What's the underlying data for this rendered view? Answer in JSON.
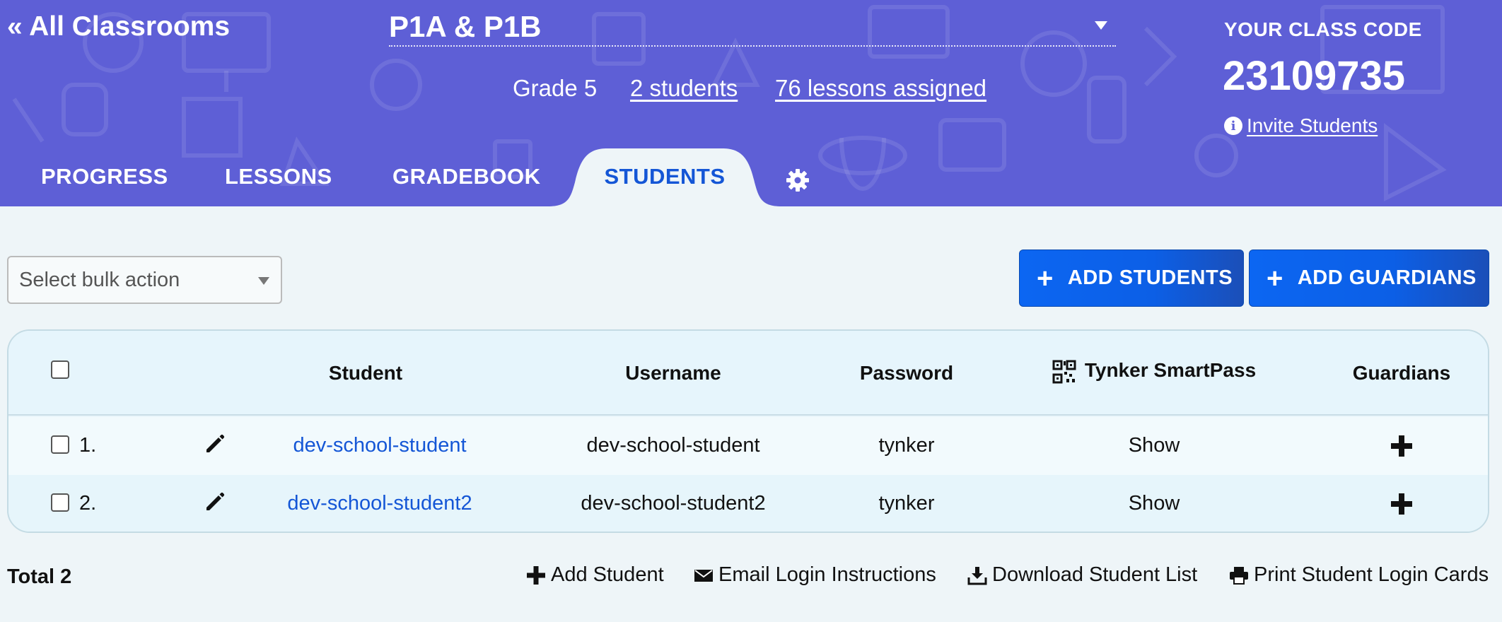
{
  "header": {
    "back_label": "« All Classrooms",
    "class_name": "P1A & P1B",
    "grade": "Grade 5",
    "students_link": "2 students",
    "lessons_link": "76 lessons assigned",
    "class_code_label": "YOUR CLASS CODE",
    "class_code": "23109735",
    "invite_label": " Invite Students",
    "bg_color": "#5e5fd6"
  },
  "tabs": [
    {
      "label": "PROGRESS",
      "active": false
    },
    {
      "label": "LESSONS",
      "active": false
    },
    {
      "label": "GRADEBOOK",
      "active": false
    },
    {
      "label": "STUDENTS",
      "active": true
    }
  ],
  "toolbar": {
    "bulk_action_placeholder": "Select bulk action",
    "add_students_label": "ADD STUDENTS",
    "add_guardians_label": "ADD GUARDIANS"
  },
  "table": {
    "columns": {
      "student": "Student",
      "username": "Username",
      "password": "Password",
      "smartpass": "Tynker SmartPass",
      "guardians": "Guardians"
    },
    "rows": [
      {
        "num": "1.",
        "student": "dev-school-student",
        "username": "dev-school-student",
        "password": "tynker",
        "smartpass": "Show"
      },
      {
        "num": "2.",
        "student": "dev-school-student2",
        "username": "dev-school-student2",
        "password": "tynker",
        "smartpass": "Show"
      }
    ]
  },
  "footer": {
    "total": "Total 2",
    "add_student": "Add Student",
    "email_instructions": "Email Login Instructions",
    "download_list": "Download Student List",
    "print_cards": "Print Student Login Cards"
  },
  "colors": {
    "primary_button": "#0c66f2",
    "link": "#1456d6",
    "page_bg": "#eef5f8"
  }
}
